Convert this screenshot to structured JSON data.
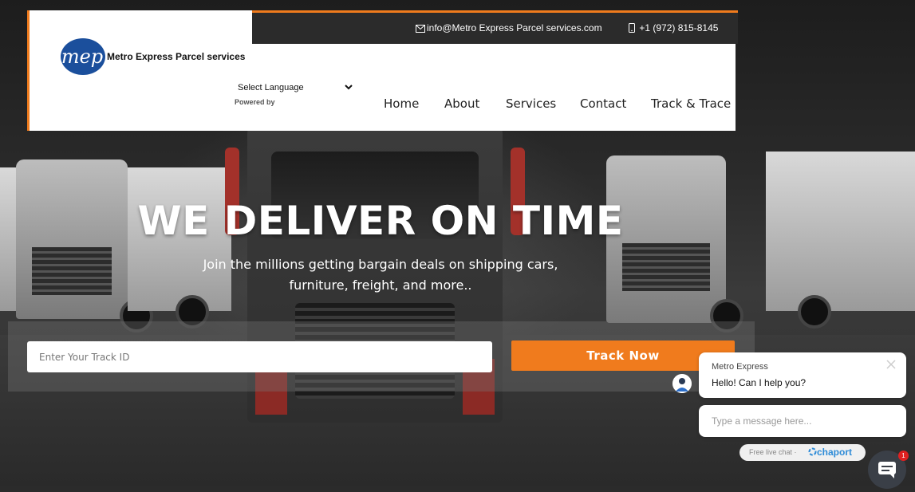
{
  "topbar": {
    "email": "info@Metro Express Parcel services.com",
    "phone": "+1 (972) 815-8145",
    "email_icon": "envelope-icon",
    "phone_icon": "mobile-phone-icon"
  },
  "brand": {
    "logo_text": "mep",
    "name": "Metro Express Parcel services"
  },
  "language": {
    "selected": "Select Language",
    "powered_by": "Powered by"
  },
  "nav": {
    "items": [
      {
        "label": "Home"
      },
      {
        "label": "About"
      },
      {
        "label": "Services"
      },
      {
        "label": "Contact"
      },
      {
        "label": "Track & Trace"
      }
    ]
  },
  "hero": {
    "headline": "WE DELIVER ON TIME",
    "subline_1": "Join the millions getting bargain deals on shipping cars,",
    "subline_2": "furniture, freight, and more.."
  },
  "track": {
    "placeholder": "Enter Your Track ID",
    "value": "",
    "button_label": "Track Now"
  },
  "chat": {
    "agent_name": "Metro Express",
    "message": "Hello! Can I help you?",
    "input_placeholder": "Type a message here...",
    "footer_text": "Free live chat ·",
    "footer_brand": "chaport",
    "badge_count": "1"
  },
  "colors": {
    "accent": "#f07b1d",
    "topbar": "#2b2b2b",
    "logo_blue": "#1b4f9c",
    "chat_brand": "#2d8bd7"
  }
}
